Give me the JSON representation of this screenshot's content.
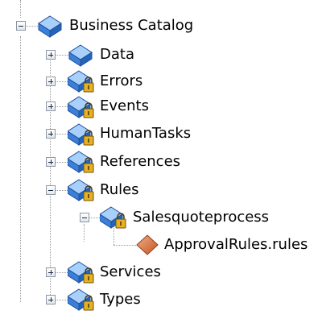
{
  "tree": {
    "root": {
      "label": "Business Catalog",
      "icon": "package-icon",
      "expanded": true
    },
    "children": [
      {
        "label": "Data",
        "icon": "package-icon",
        "expanded": false
      },
      {
        "label": "Errors",
        "icon": "locked-package-icon",
        "expanded": false
      },
      {
        "label": "Events",
        "icon": "locked-package-icon",
        "expanded": false
      },
      {
        "label": "HumanTasks",
        "icon": "locked-package-icon",
        "expanded": false
      },
      {
        "label": "References",
        "icon": "locked-package-icon",
        "expanded": false
      },
      {
        "label": "Rules",
        "icon": "locked-package-icon",
        "expanded": true,
        "children": [
          {
            "label": "Salesquoteprocess",
            "icon": "locked-package-icon",
            "expanded": true,
            "children": [
              {
                "label": "ApprovalRules.rules",
                "icon": "rules-file-icon"
              }
            ]
          }
        ]
      },
      {
        "label": "Services",
        "icon": "locked-package-icon",
        "expanded": false
      },
      {
        "label": "Types",
        "icon": "locked-package-icon",
        "expanded": false
      }
    ]
  },
  "colors": {
    "package_blue": "#3b7fd8",
    "package_light": "#a9d0fb",
    "lock_gold": "#e6b122",
    "rules_orange": "#d8703a"
  }
}
